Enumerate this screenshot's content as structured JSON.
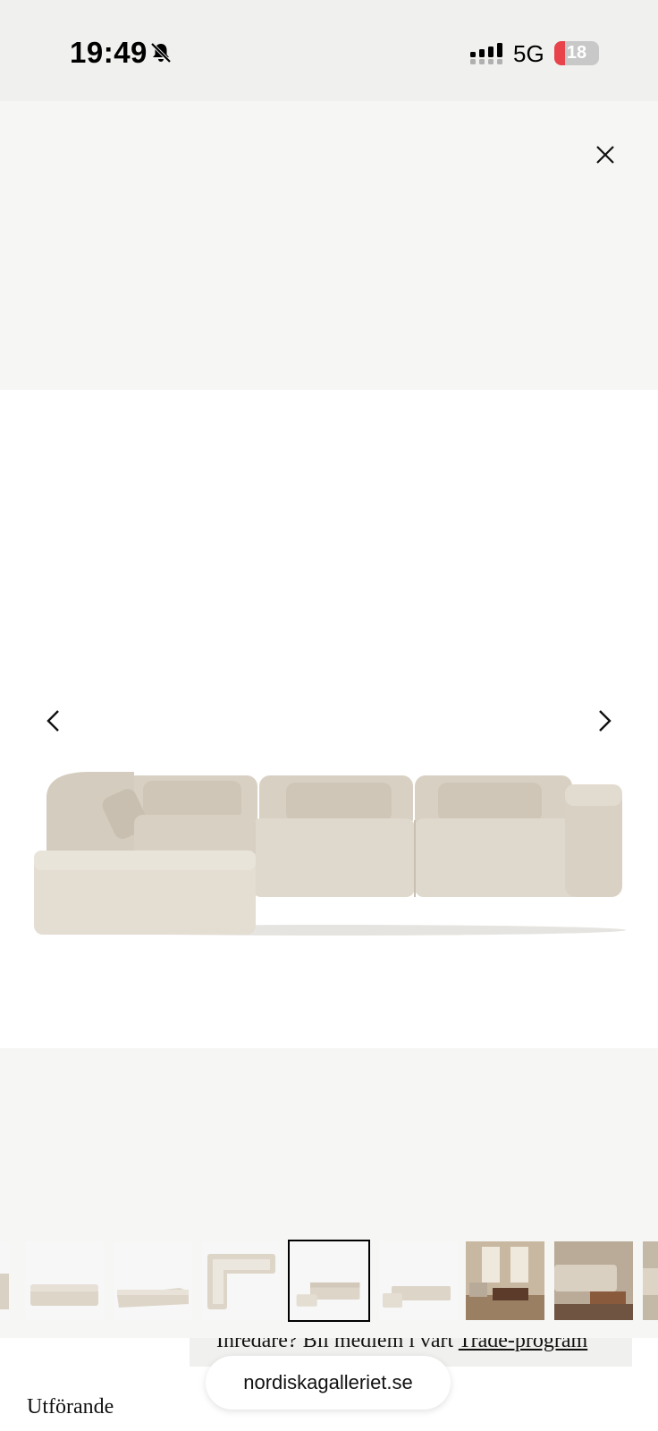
{
  "status_bar": {
    "time": "19:49",
    "network": "5G",
    "battery": "18",
    "battery_color": "#e8424a"
  },
  "gallery": {
    "close_icon": "close-icon",
    "prev_icon": "chevron-left-icon",
    "next_icon": "chevron-right-icon",
    "selected_index": 4,
    "thumbnails": [
      {
        "name": "thumb-partial"
      },
      {
        "name": "thumb-sofa-front"
      },
      {
        "name": "thumb-sofa-angle"
      },
      {
        "name": "thumb-sofa-top"
      },
      {
        "name": "thumb-sofa-corner"
      },
      {
        "name": "thumb-sofa-corner-angle"
      },
      {
        "name": "thumb-room-dining"
      },
      {
        "name": "thumb-room-living"
      },
      {
        "name": "thumb-partial-end"
      }
    ]
  },
  "page": {
    "trade_prefix": "Inredare? Bli medlem i vårt ",
    "trade_link": "Trade-program",
    "variant_label": "Utförande"
  },
  "browser": {
    "url": "nordiskagalleriet.se"
  }
}
